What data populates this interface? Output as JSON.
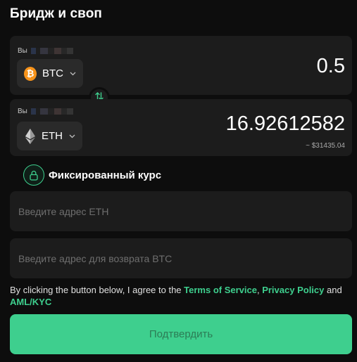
{
  "title": "Бридж и своп",
  "send": {
    "label": "Вы",
    "coin": "BTC",
    "coin_symbol": "₿",
    "amount": "0.5"
  },
  "receive": {
    "label": "Вы",
    "coin": "ETH",
    "amount": "16.92612582",
    "usd_estimate": "~ $31435.04"
  },
  "fixed_rate_label": "Фиксированный курс",
  "inputs": {
    "eth_address_placeholder": "Введите адрес ETH",
    "btc_refund_placeholder": "Введите адрес для возврата BTC"
  },
  "terms": {
    "prefix": "By clicking the button below, I agree to the ",
    "terms_link": "Terms of Service",
    "comma": ", ",
    "privacy_link": "Privacy Policy",
    "and": " and ",
    "aml_link": "AML/KYC"
  },
  "confirm_label": "Подтвердить",
  "colors": {
    "accent": "#3ecf8e",
    "btc": "#f7931a",
    "card": "#1c1c1c",
    "background": "#0d0d0d"
  }
}
